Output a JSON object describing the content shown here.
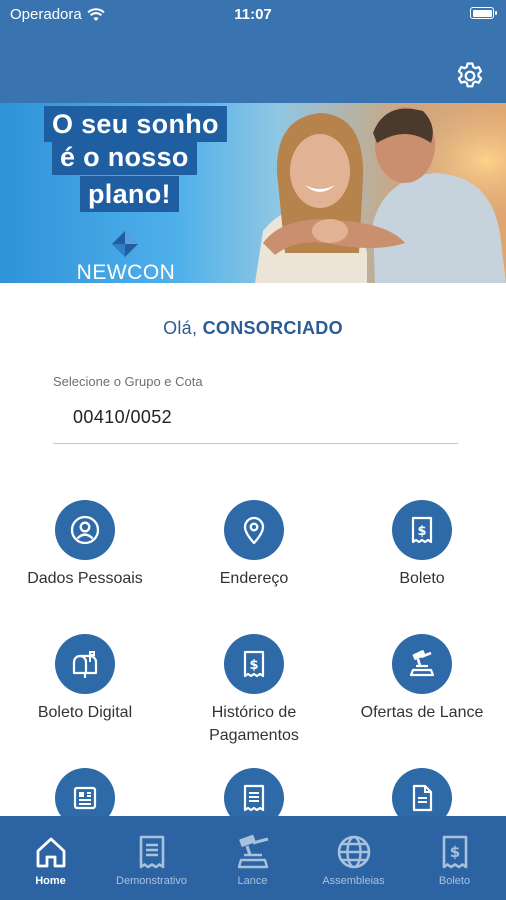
{
  "status_bar": {
    "carrier": "Operadora",
    "time": "11:07",
    "battery_level": 1.0
  },
  "banner": {
    "headline_1": "O seu sonho",
    "headline_2": "é o nosso",
    "headline_3": "plano!",
    "logo_text": "NEWCON"
  },
  "greeting": {
    "prefix": "Olá, ",
    "name": "CONSORCIADO"
  },
  "group_select": {
    "label": "Selecione o Grupo e Cota",
    "value": "00410/0052"
  },
  "menu": {
    "dados_pessoais": "Dados Pessoais",
    "endereco": "Endereço",
    "boleto": "Boleto",
    "boleto_digital": "Boleto Digital",
    "historico_1": "Histórico de",
    "historico_2": "Pagamentos",
    "ofertas_lance": "Ofertas de Lance"
  },
  "tabs": {
    "home": "Home",
    "demonstrativo": "Demonstrativo",
    "lance": "Lance",
    "assembleias": "Assembleias",
    "boleto": "Boleto"
  },
  "colors": {
    "primary": "#3a74b0",
    "icon_circle": "#2f6aa8",
    "tabbar": "#2c64a3",
    "text_accent": "#2c5c95"
  }
}
